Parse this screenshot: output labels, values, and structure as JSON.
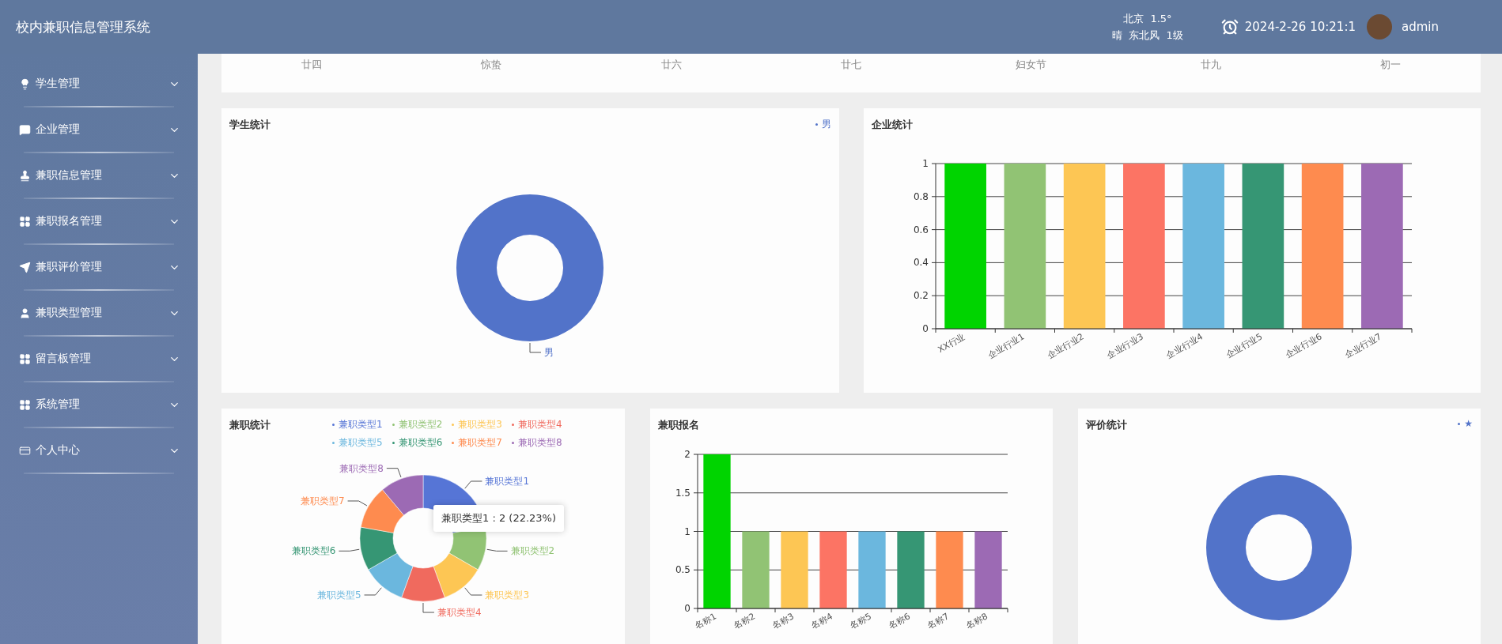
{
  "header": {
    "title": "校内兼职信息管理系统",
    "weather": {
      "city_temp": "北京  1.5°",
      "condition": "晴  东北风  1级"
    },
    "datetime": "2024-2-26 10:21:1",
    "user": "admin"
  },
  "sidebar": {
    "items": [
      {
        "label": "学生管理",
        "kind": "bulb"
      },
      {
        "label": "企业管理",
        "kind": "chat"
      },
      {
        "label": "兼职信息管理",
        "kind": "stamp"
      },
      {
        "label": "兼职报名管理",
        "kind": "grid"
      },
      {
        "label": "兼职评价管理",
        "kind": "plane"
      },
      {
        "label": "兼职类型管理",
        "kind": "user"
      },
      {
        "label": "留言板管理",
        "kind": "grid"
      },
      {
        "label": "系统管理",
        "kind": "grid"
      },
      {
        "label": "个人中心",
        "kind": "card"
      }
    ]
  },
  "calendar_strip": {
    "days": [
      "廿四",
      "惊蛰",
      "廿六",
      "廿七",
      "妇女节",
      "廿九",
      "初一"
    ]
  },
  "student_stats": {
    "title": "学生统计",
    "legend": [
      "男"
    ],
    "slice_labels": [
      "男"
    ]
  },
  "enterprise_stats": {
    "title": "企业统计",
    "chart_data": {
      "type": "bar",
      "categories": [
        "XX行业",
        "企业行业1",
        "企业行业2",
        "企业行业3",
        "企业行业4",
        "企业行业5",
        "企业行业6",
        "企业行业7"
      ],
      "values": [
        1,
        1,
        1,
        1,
        1,
        1,
        1,
        1
      ],
      "ylim": [
        0,
        1
      ],
      "yticks": [
        0,
        0.2,
        0.4,
        0.6,
        0.8,
        1
      ],
      "grid": true
    }
  },
  "job_stats": {
    "title": "兼职统计",
    "legend": [
      "兼职类型1",
      "兼职类型2",
      "兼职类型3",
      "兼职类型4",
      "兼职类型5",
      "兼职类型6",
      "兼职类型7",
      "兼职类型8"
    ],
    "chart_data": {
      "type": "donut",
      "categories": [
        "兼职类型1",
        "兼职类型2",
        "兼职类型3",
        "兼职类型4",
        "兼职类型5",
        "兼职类型6",
        "兼职类型7",
        "兼职类型8"
      ],
      "values": [
        22.23,
        11.11,
        11.11,
        11.11,
        11.11,
        11.11,
        11.11,
        11.11
      ]
    },
    "tooltip": "兼职类型1 : 2 (22.23%)"
  },
  "registration": {
    "title": "兼职报名",
    "chart_data": {
      "type": "bar",
      "categories": [
        "名称1",
        "名称2",
        "名称3",
        "名称4",
        "名称5",
        "名称6",
        "名称7",
        "名称8"
      ],
      "values": [
        2,
        1,
        1,
        1,
        1,
        1,
        1,
        1
      ],
      "ylim": [
        0,
        2
      ],
      "yticks": [
        0,
        0.5,
        1,
        1.5,
        2
      ],
      "grid": true
    }
  },
  "rating_stats": {
    "title": "评价统计",
    "legend": [
      "★"
    ]
  }
}
